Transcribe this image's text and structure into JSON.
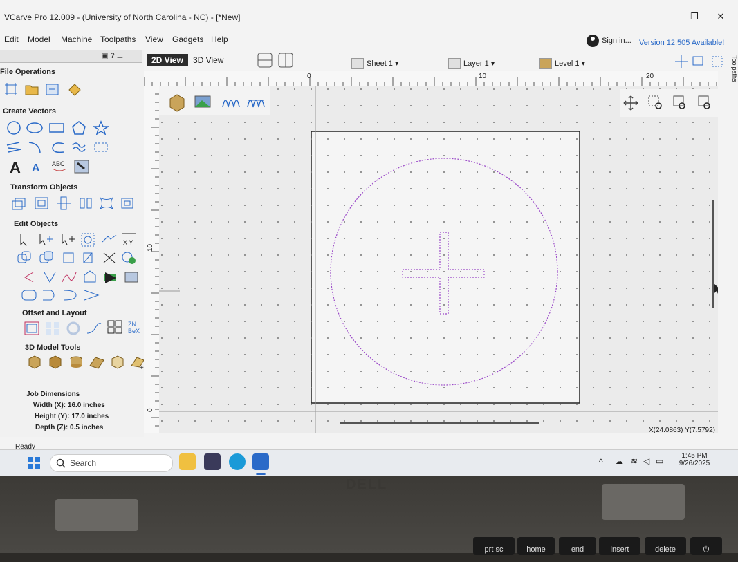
{
  "title_bar": {
    "title": "VCarve Pro 12.009 - (University of North Carolina - NC) - [*New]"
  },
  "menu": [
    "Edit",
    "Model",
    "Machine",
    "Toolpaths",
    "View",
    "Gadgets",
    "Help"
  ],
  "account": {
    "sign_in": "Sign in...",
    "version_notice": "Version 12.505 Available!"
  },
  "view_tabs": {
    "tab_2d": "2D View",
    "tab_3d": "3D View"
  },
  "selectors": {
    "sheet": "Sheet 1",
    "layer": "Layer 1",
    "level": "Level 1"
  },
  "panel": {
    "sections": {
      "file_operations": "File Operations",
      "create_vectors": "Create Vectors",
      "transform_objects": "Transform Objects",
      "edit_objects": "Edit Objects",
      "offset_layout": "Offset and Layout",
      "model_tools": "3D Model Tools"
    },
    "job": {
      "heading": "Job Dimensions",
      "width": "Width  (X): 16.0 inches",
      "height": "Height (Y): 17.0 inches",
      "depth": "Depth  (Z): 0.5 inches"
    }
  },
  "ruler": {
    "h_labels": [
      "0",
      "10",
      "20"
    ],
    "v_labels": [
      "10",
      "0"
    ]
  },
  "status": {
    "text": "Ready",
    "coords": "X(24.0863) Y(7.5792)"
  },
  "side_tab": "Toolpaths",
  "taskbar": {
    "search": "Search",
    "time": "1:45 PM",
    "date": "9/26/2025"
  },
  "hardware": {
    "logo": "DELL",
    "keys": [
      "prt sc",
      "home",
      "end",
      "insert",
      "delete"
    ]
  }
}
